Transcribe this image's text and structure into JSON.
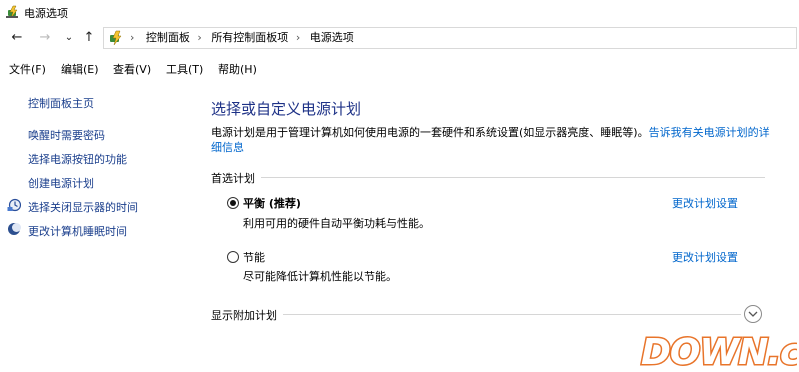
{
  "window": {
    "title": "电源选项",
    "icon": "power-options-icon"
  },
  "navbar": {
    "back_glyph": "←",
    "forward_glyph": "→",
    "recent_glyph": "⌄",
    "up_glyph": "↑",
    "crumb_prefix": "›",
    "crumbs": [
      "控制面板",
      "所有控制面板项",
      "电源选项"
    ],
    "separator": "›"
  },
  "menubar": {
    "items": [
      "文件(F)",
      "编辑(E)",
      "查看(V)",
      "工具(T)",
      "帮助(H)"
    ]
  },
  "sidebar": {
    "items": [
      "控制面板主页",
      "唤醒时需要密码",
      "选择电源按钮的功能",
      "创建电源计划",
      "选择关闭显示器的时间",
      "更改计算机睡眠时间"
    ]
  },
  "main": {
    "title": "选择或自定义电源计划",
    "description": "电源计划是用于管理计算机如何使用电源的一套硬件和系统设置(如显示器亮度、睡眠等)。",
    "description_link": "告诉我有关电源计划的详细信息",
    "preferred_label": "首选计划",
    "plans": [
      {
        "name": "平衡 (推荐)",
        "desc": "利用可用的硬件自动平衡功耗与性能。",
        "link": "更改计划设置",
        "selected": true
      },
      {
        "name": "节能",
        "desc": "尽可能降低计算机性能以节能。",
        "link": "更改计划设置",
        "selected": false
      }
    ],
    "additional_label": "显示附加计划"
  },
  "watermark": {
    "text": "DOWN.cc"
  },
  "colors": {
    "link": "#0066cc",
    "heading": "#1e3287",
    "sidebar_link": "#1a3e8c",
    "watermark": "#e8742a"
  }
}
